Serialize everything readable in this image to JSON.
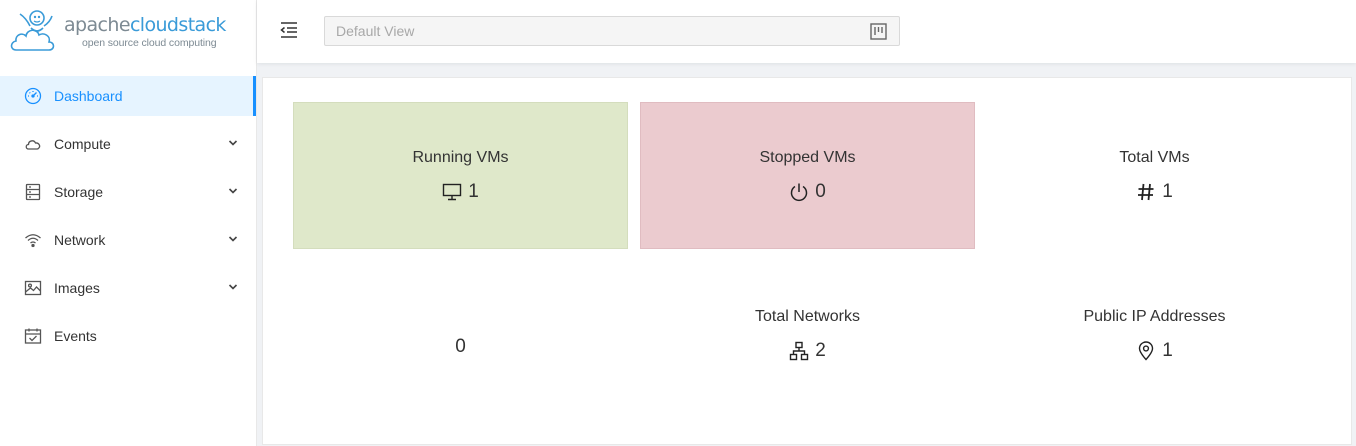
{
  "app": {
    "logo_word_1": "apache",
    "logo_word_2": "cloudstack",
    "logo_tagline": "open source cloud computing",
    "accent": "#1890ff"
  },
  "sidebar": {
    "items": [
      {
        "label": "Dashboard",
        "icon": "dashboard-icon",
        "active": true,
        "expandable": false
      },
      {
        "label": "Compute",
        "icon": "cloud-icon",
        "active": false,
        "expandable": true
      },
      {
        "label": "Storage",
        "icon": "database-icon",
        "active": false,
        "expandable": true
      },
      {
        "label": "Network",
        "icon": "wifi-icon",
        "active": false,
        "expandable": true
      },
      {
        "label": "Images",
        "icon": "picture-icon",
        "active": false,
        "expandable": true
      },
      {
        "label": "Events",
        "icon": "schedule-icon",
        "active": false,
        "expandable": false
      }
    ]
  },
  "header": {
    "view_select_placeholder": "Default View"
  },
  "dashboard": {
    "tiles": [
      {
        "title": "Running VMs",
        "value": "1",
        "icon": "desktop-icon",
        "color": "#dfe8ca"
      },
      {
        "title": "Stopped VMs",
        "value": "0",
        "icon": "power-icon",
        "color": "#ebcbcf"
      },
      {
        "title": "Total VMs",
        "value": "1",
        "icon": "number-icon"
      },
      {
        "title": "",
        "value": "0"
      },
      {
        "title": "Total Networks",
        "value": "2",
        "icon": "apartment-icon"
      },
      {
        "title": "Public IP Addresses",
        "value": "1",
        "icon": "location-pin-icon"
      }
    ]
  }
}
